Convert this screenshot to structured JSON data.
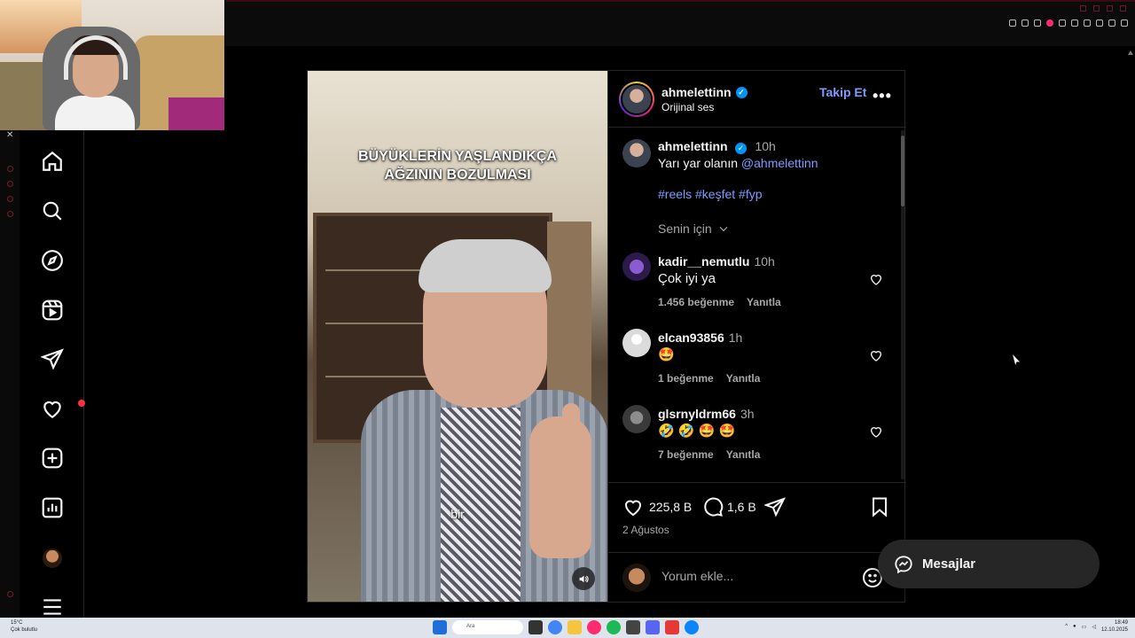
{
  "post": {
    "username": "ahmelettinn",
    "audio": "Orijinal ses",
    "follow_label": "Takip Et",
    "more_label": "•••",
    "video_caption_line1": "BÜYÜKLERİN YAŞLANDIKÇA",
    "video_caption_line2": "AĞZININ BOZULMASI",
    "video_subtitle": "bir",
    "caption": {
      "username": "ahmelettinn",
      "time": "10h",
      "text": "Yarı yar olanın",
      "mention": "@ahmelettinn",
      "hashtags": "#reels #keşfet #fyp"
    },
    "sort_label": "Senin için",
    "comments": [
      {
        "username": "kadir__nemutlu",
        "time": "10h",
        "text": "Çok iyi ya",
        "likes": "1.456 beğenme",
        "reply": "Yanıtla"
      },
      {
        "username": "elcan93856",
        "time": "1h",
        "text": "🤩",
        "likes": "1 beğenme",
        "reply": "Yanıtla"
      },
      {
        "username": "glsrnyldrm66",
        "time": "3h",
        "text": "🤣 🤣 🤩 🤩",
        "likes": "7 beğenme",
        "reply": "Yanıtla"
      }
    ],
    "like_count": "225,8 B",
    "comment_count": "1,6 B",
    "date": "2 Ağustos",
    "add_comment_placeholder": "Yorum ekle..."
  },
  "messages_label": "Mesajlar",
  "sidebar": {
    "items": [
      "home-icon",
      "search-icon",
      "explore-icon",
      "reels-icon",
      "messages-icon",
      "notifications-icon",
      "create-icon",
      "dashboard-icon",
      "profile-avatar",
      "menu-icon"
    ]
  },
  "taskbar": {
    "weather_temp": "15°C",
    "weather_desc": "Çok bulutlu",
    "search_label": "Ara",
    "time": "18:49",
    "date": "12.10.2025"
  },
  "colors": {
    "background": "#000000",
    "link": "#7f9bff",
    "border": "#262626",
    "notification": "#ff3040",
    "verified": "#0095f6"
  }
}
